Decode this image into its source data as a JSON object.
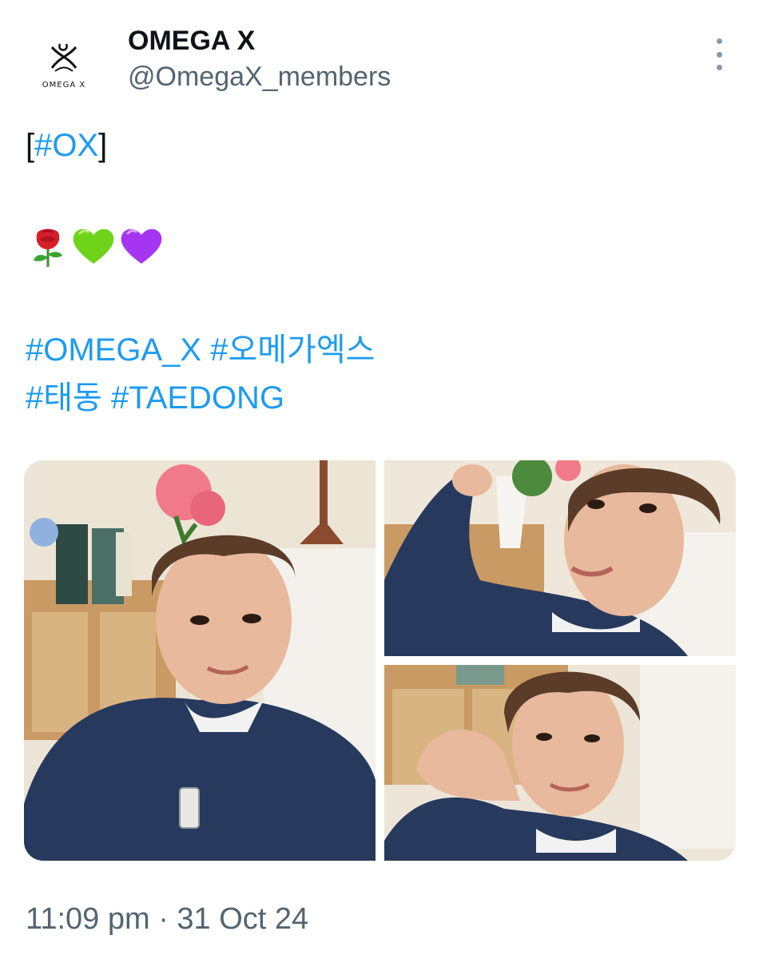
{
  "tweet": {
    "display_name": "OMEGA X",
    "handle": "@OmegaX_members",
    "avatar_logo_text": "OMEGA X",
    "more_icon": "more-vertical-icon",
    "text": {
      "line1_open": "[",
      "line1_hashtag": "#OX",
      "line1_close": "]",
      "emojis": [
        "rose-emoji",
        "green-heart-emoji",
        "purple-heart-emoji"
      ],
      "hashtags_row1": [
        "#OMEGA_X",
        "#오메가엑스"
      ],
      "hashtags_row2": [
        "#태동",
        "#TAEDONG"
      ]
    },
    "photos": [
      {
        "name": "selfie-photo-1",
        "description": "selfie"
      },
      {
        "name": "selfie-photo-2",
        "description": "selfie"
      },
      {
        "name": "selfie-photo-3",
        "description": "selfie"
      }
    ],
    "timestamp": {
      "time": "11:09 pm",
      "separator": "·",
      "date": "31 Oct 24"
    }
  },
  "colors": {
    "link": "#1d9bf0",
    "text": "#0f1419",
    "secondary": "#536471"
  }
}
